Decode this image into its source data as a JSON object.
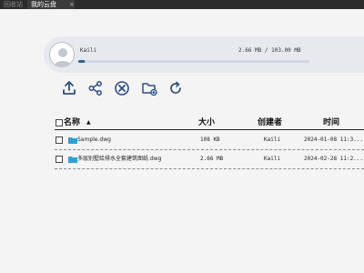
{
  "tabs": {
    "previous_label": "回收站",
    "active_label": "我的云盘",
    "close_glyph": "×"
  },
  "profile": {
    "username": "Kaili",
    "storage_text": "2.66 MB / 103.00 MB",
    "quota_fraction": 0.026
  },
  "toolbar": {
    "buttons": [
      {
        "icon": "upload-icon"
      },
      {
        "icon": "share-icon"
      },
      {
        "icon": "delete-icon"
      },
      {
        "icon": "new-folder-icon"
      },
      {
        "icon": "refresh-icon"
      }
    ]
  },
  "table": {
    "columns": {
      "name": "名称",
      "sort_indicator": "▲",
      "size": "大小",
      "creator": "创建者",
      "time": "时间"
    },
    "rows": [
      {
        "name": "Sample.dwg",
        "size": "108 KB",
        "creator": "Kaili",
        "time": "2024-01-08 11:3..."
      },
      {
        "name": "多层别墅给排水全套建筑图纸.dwg",
        "size": "2.66 MB",
        "creator": "Kaili",
        "time": "2024-02-28 11:2..."
      }
    ]
  },
  "colors": {
    "accent": "#365f96",
    "icon_blue": "#2b4f7e",
    "file_icon": "#2aa2d8"
  }
}
